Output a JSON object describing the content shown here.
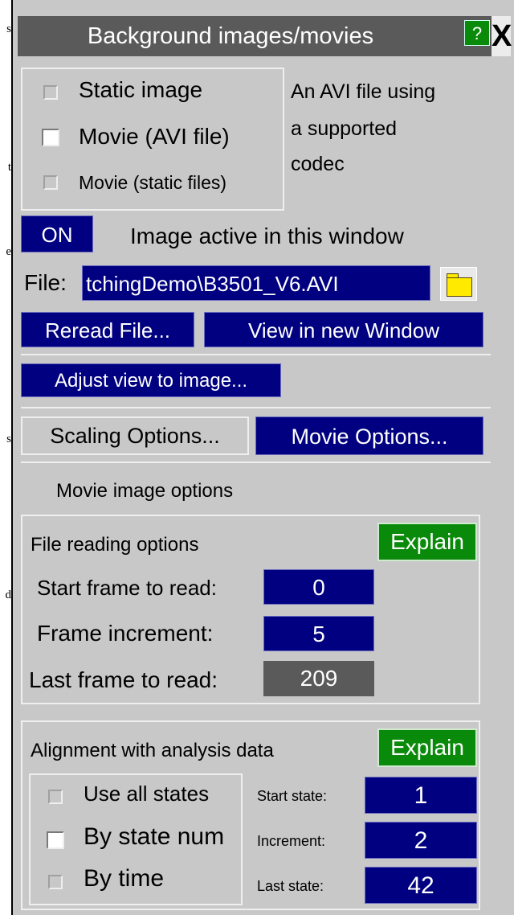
{
  "left_edge_fragments": [
    "s",
    "t",
    "e",
    "s",
    "d"
  ],
  "window": {
    "title": "Background images/movies",
    "help_label": "?",
    "close_label": "X"
  },
  "source_type": {
    "options": [
      "Static image",
      "Movie (AVI file)",
      "Movie (static files)"
    ],
    "selected": "Movie (AVI file)",
    "description_lines": [
      "An AVI file using",
      "a supported",
      "codec"
    ]
  },
  "active": {
    "toggle_label": "ON",
    "label": "Image active in this window"
  },
  "file": {
    "label": "File:",
    "value": "tchingDemo\\B3501_V6.AVI"
  },
  "buttons": {
    "reread": "Reread File...",
    "view_new_window": "View in new Window",
    "adjust_view": "Adjust view to image...",
    "scaling_options": "Scaling Options...",
    "movie_options": "Movie Options..."
  },
  "movie_options": {
    "heading": "Movie image options",
    "file_reading": {
      "label": "File reading options",
      "explain": "Explain",
      "start_frame_label": "Start frame to read:",
      "start_frame": "0",
      "frame_increment_label": "Frame increment:",
      "frame_increment": "5",
      "last_frame_label": "Last frame to read:",
      "last_frame": "209"
    },
    "alignment": {
      "label": "Alignment with analysis data",
      "explain": "Explain",
      "options": [
        "Use all states",
        "By state num",
        "By time"
      ],
      "selected": "By state num",
      "start_state_label": "Start state:",
      "start_state": "1",
      "increment_label": "Increment:",
      "increment": "2",
      "last_state_label": "Last state:",
      "last_state": "42"
    }
  },
  "colors": {
    "panel": "#c8c8c8",
    "title_bar": "#5a5a5a",
    "button_blue": "#000080",
    "explain_green": "#0a8a0a",
    "folder_yellow": "#ffea00"
  }
}
